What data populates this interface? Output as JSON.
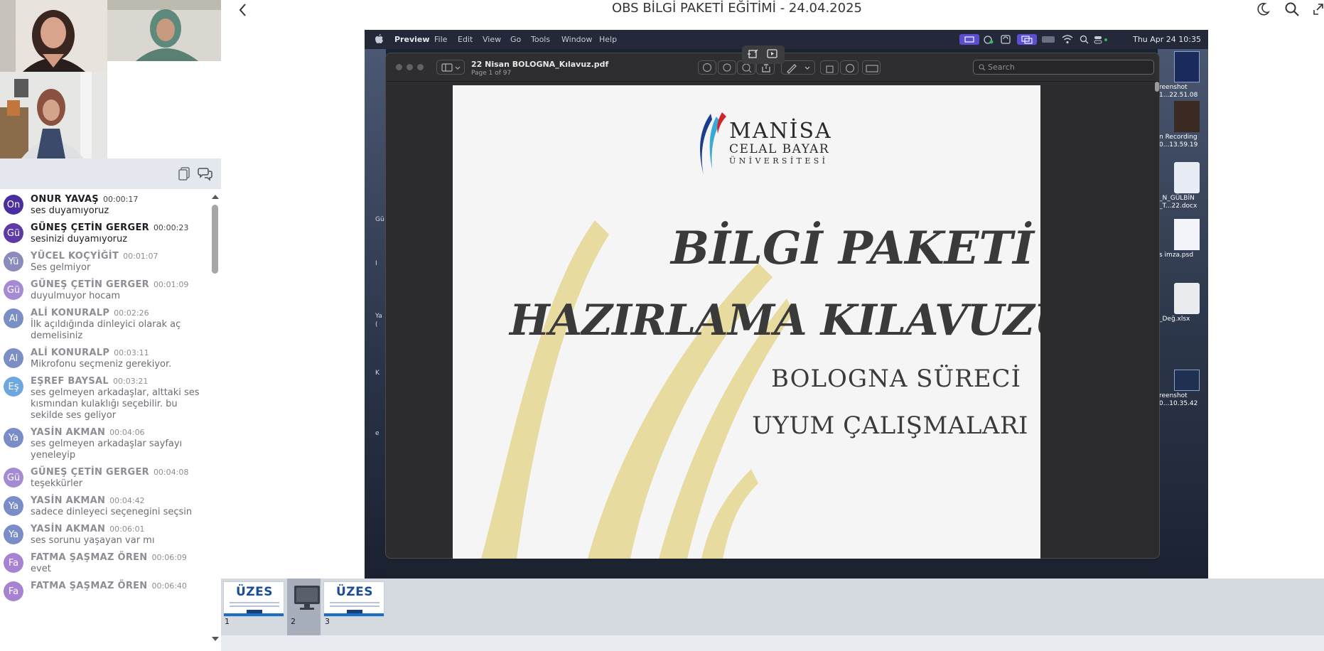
{
  "header": {
    "title": "OBS BİLGİ PAKETİ EĞİTİMİ - 24.04.2025"
  },
  "chat": {
    "messages": [
      {
        "initials": "On",
        "name": "ONUR YAVAŞ",
        "time": "00:00:17",
        "text": "ses duyamıyoruz",
        "color": "#4a2ea0",
        "style": "bold"
      },
      {
        "initials": "Gü",
        "name": "GÜNEŞ ÇETİN GERGER",
        "time": "00:00:23",
        "text": "sesinizi duyamıyoruz",
        "color": "#5d3aa6",
        "style": "bold"
      },
      {
        "initials": "Yü",
        "name": "YÜCEL KOÇYİĞİT",
        "time": "00:01:07",
        "text": "Ses gelmiyor",
        "color": "#8b8bbd",
        "style": "faded"
      },
      {
        "initials": "Gü",
        "name": "GÜNEŞ ÇETİN GERGER",
        "time": "00:01:09",
        "text": "duyulmuyor hocam",
        "color": "#a58ad4",
        "style": "faded"
      },
      {
        "initials": "Al",
        "name": "ALİ KONURALP",
        "time": "00:02:26",
        "text": "İlk açıldığında dinleyici olarak aç demelisiniz",
        "color": "#7a8fc4",
        "style": "faded"
      },
      {
        "initials": "Al",
        "name": "ALİ KONURALP",
        "time": "00:03:11",
        "text": "Mikrofonu seçmeniz gerekiyor.",
        "color": "#7a8fc4",
        "style": "faded"
      },
      {
        "initials": "Eş",
        "name": "EŞREF BAYSAL",
        "time": "00:03:21",
        "text": "ses gelmeyen arkadaşlar, alttaki ses kısmından kulaklığı seçebilir. bu sekilde ses geliyor",
        "color": "#6ea7e0",
        "style": "faded"
      },
      {
        "initials": "Ya",
        "name": "YASİN AKMAN",
        "time": "00:04:06",
        "text": "ses gelmeyen arkadaşlar sayfayı yeneleyip",
        "color": "#7b8dc8",
        "style": "faded"
      },
      {
        "initials": "Gü",
        "name": "GÜNEŞ ÇETİN GERGER",
        "time": "00:04:08",
        "text": "teşekkürler",
        "color": "#a58ad4",
        "style": "faded"
      },
      {
        "initials": "Ya",
        "name": "YASİN AKMAN",
        "time": "00:04:42",
        "text": "sadece dinleyeci seçenegini seçsin",
        "color": "#7b8dc8",
        "style": "faded"
      },
      {
        "initials": "Ya",
        "name": "YASİN AKMAN",
        "time": "00:06:01",
        "text": "ses sorunu yaşayan var mı",
        "color": "#7b8dc8",
        "style": "faded"
      },
      {
        "initials": "Fa",
        "name": "FATMA ŞAŞMAZ ÖREN",
        "time": "00:06:09",
        "text": "evet",
        "color": "#a782d0",
        "style": "faded"
      },
      {
        "initials": "Fa",
        "name": "FATMA ŞAŞMAZ ÖREN",
        "time": "00:06:40",
        "text": "",
        "color": "#a782d0",
        "style": "faded"
      }
    ]
  },
  "screen": {
    "menubar": {
      "app": "Preview",
      "items": [
        "File",
        "Edit",
        "View",
        "Go",
        "Tools",
        "Window",
        "Help"
      ],
      "clock": "Thu Apr 24  10:35"
    },
    "desktop_left_labels": [
      "Gü",
      "I",
      "Ya",
      "(",
      "K",
      "e"
    ],
    "desktop_files": [
      {
        "line1": "reenshot",
        "line2": "1...22.51.08",
        "color": "#1a2a5a"
      },
      {
        "line1": "n Recording",
        "line2": "0...13.59.19",
        "color": "#3a2a22"
      },
      {
        "line1": "_N_GÜLBİN",
        "line2": "_T...22.docx",
        "color": "#e8ecf4"
      },
      {
        "line1": "s imza.psd",
        "line2": "",
        "color": "#f2f4fa"
      },
      {
        "line1": "_Değ.xlsx",
        "line2": "",
        "color": "#e9ebee"
      },
      {
        "line1": "reenshot",
        "line2": "0...10.35.42",
        "color": "#203050"
      }
    ],
    "preview": {
      "doc_name": "22 Nisan BOLOGNA_Kılavuz.pdf",
      "doc_page": "Page 1 of 97",
      "search_placeholder": "Search"
    },
    "page": {
      "logo_line1": "MANİSA",
      "logo_line2": "CELAL BAYAR",
      "logo_line3": "ÜNİVERSİTESİ",
      "title1": "BİLGİ PAKETİ",
      "title2": "HAZIRLAMA KILAVUZU",
      "subtitle1": "BOLOGNA SÜRECİ",
      "subtitle2": "UYUM ÇALIŞMALARI"
    }
  },
  "thumbnails": [
    {
      "num": "1",
      "label": "ÜZES"
    },
    {
      "num": "2",
      "label": ""
    },
    {
      "num": "3",
      "label": "ÜZES"
    }
  ]
}
